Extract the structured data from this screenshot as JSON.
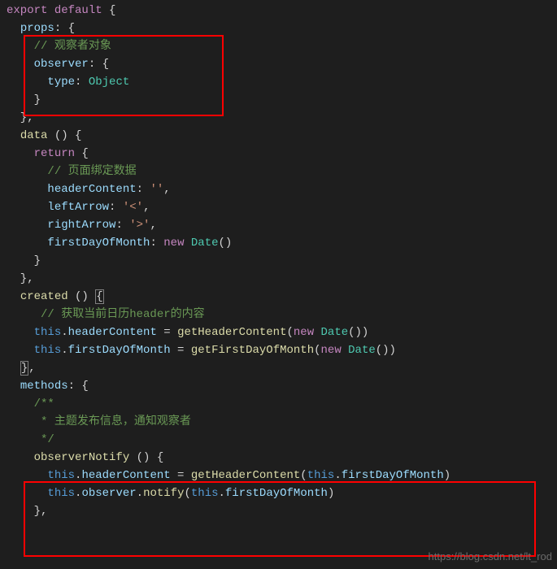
{
  "lines": {
    "l1_export": "export",
    "l1_default": "default",
    "l2_props": "props",
    "l3_comment": "// 观察者对象",
    "l4_observer": "observer",
    "l5_type": "type",
    "l5_object": "Object",
    "l9_data": "data",
    "l10_return": "return",
    "l11_comment": "// 页面绑定数据",
    "l12_headerContent": "headerContent",
    "l12_val": "''",
    "l13_leftArrow": "leftArrow",
    "l13_val": "'<'",
    "l14_rightArrow": "rightArrow",
    "l14_val": "'>'",
    "l15_firstDayOfMonth": "firstDayOfMonth",
    "l15_new": "new",
    "l15_Date": "Date",
    "l18_created": "created",
    "l19_comment": "// 获取当前日历header的内容",
    "l20_this": "this",
    "l20_headerContent": "headerContent",
    "l20_getHeaderContent": "getHeaderContent",
    "l20_new": "new",
    "l20_Date": "Date",
    "l21_this": "this",
    "l21_firstDayOfMonth": "firstDayOfMonth",
    "l21_getFirstDayOfMonth": "getFirstDayOfMonth",
    "l21_new": "new",
    "l21_Date": "Date",
    "l23_methods": "methods",
    "l24_doc1": "/**",
    "l25_doc2": " * 主题发布信息，通知观察者",
    "l26_doc3": " */",
    "l27_observerNotify": "observerNotify",
    "l28_this1": "this",
    "l28_headerContent": "headerContent",
    "l28_getHeaderContent": "getHeaderContent",
    "l28_this2": "this",
    "l28_firstDayOfMonth": "firstDayOfMonth",
    "l29_this1": "this",
    "l29_observer": "observer",
    "l29_notify": "notify",
    "l29_this2": "this",
    "l29_firstDayOfMonth": "firstDayOfMonth"
  },
  "watermark": "https://blog.csdn.net/lt_rod"
}
